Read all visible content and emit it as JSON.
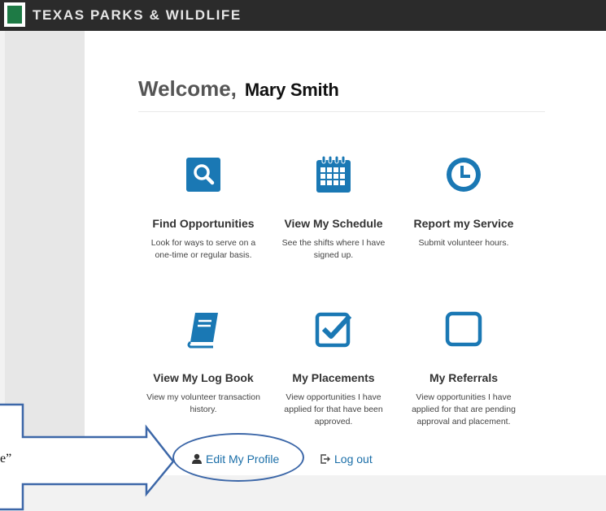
{
  "header": {
    "brand": "TEXAS PARKS & WILDLIFE"
  },
  "welcome": {
    "greeting": "Welcome,",
    "name": "Mary Smith"
  },
  "tiles": [
    {
      "icon": "search-icon",
      "title": "Find Opportunities",
      "desc": "Look for ways to serve on a one-time or regular basis."
    },
    {
      "icon": "calendar-icon",
      "title": "View My Schedule",
      "desc": "See the shifts where I have signed up."
    },
    {
      "icon": "clock-icon",
      "title": "Report my Service",
      "desc": "Submit volunteer hours."
    },
    {
      "icon": "book-icon",
      "title": "View My Log Book",
      "desc": "View my volunteer transaction history."
    },
    {
      "icon": "checkbox-icon",
      "title": "My Placements",
      "desc": "View opportunities I have applied for that have been approved."
    },
    {
      "icon": "square-icon",
      "title": "My Referrals",
      "desc": "View opportunities I have applied for that are pending approval and placement."
    }
  ],
  "links": {
    "edit_profile": "Edit My Profile",
    "logout": "Log out"
  },
  "annotation": {
    "quote_fragment": "e”"
  },
  "colors": {
    "accent": "#1a78b4",
    "topbar": "#2b2b2b",
    "logo_green": "#1e7a45",
    "oval": "#3c67a8"
  }
}
